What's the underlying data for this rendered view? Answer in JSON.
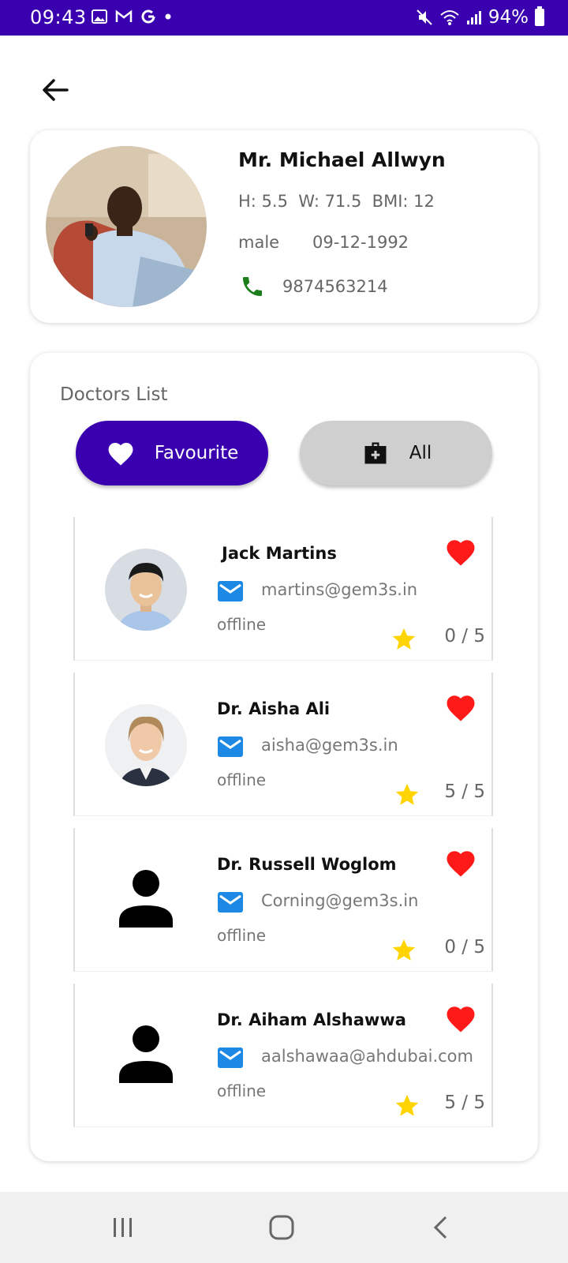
{
  "status_bar": {
    "time": "09:43",
    "battery": "94%"
  },
  "profile": {
    "name": "Mr. Michael Allwyn",
    "metrics": "H: 5.5  W: 71.5  BMI: 12",
    "gender": "male",
    "dob": "09-12-1992",
    "phone": "9874563214"
  },
  "doctors_section": {
    "title": "Doctors List",
    "tabs": {
      "favourite_label": "Favourite",
      "all_label": "All"
    }
  },
  "doctors": [
    {
      "name": "Jack Martins",
      "email": "martins@gem3s.in",
      "status": "offline",
      "rating": "0 / 5"
    },
    {
      "name": "Dr. Aisha Ali",
      "email": "aisha@gem3s.in",
      "status": "offline",
      "rating": "5 / 5"
    },
    {
      "name": "Dr. Russell Woglom",
      "email": "Corning@gem3s.in",
      "status": "offline",
      "rating": "0 / 5"
    },
    {
      "name": "Dr. Aiham Alshawwa",
      "email": "aalshawaa@ahdubai.com",
      "status": "offline",
      "rating": "5 / 5"
    }
  ],
  "colors": {
    "primary": "#3a00b0",
    "heart": "#ff1a1a",
    "star": "#ffd400",
    "mail": "#1e88e5",
    "phone": "#1a7f1a"
  }
}
